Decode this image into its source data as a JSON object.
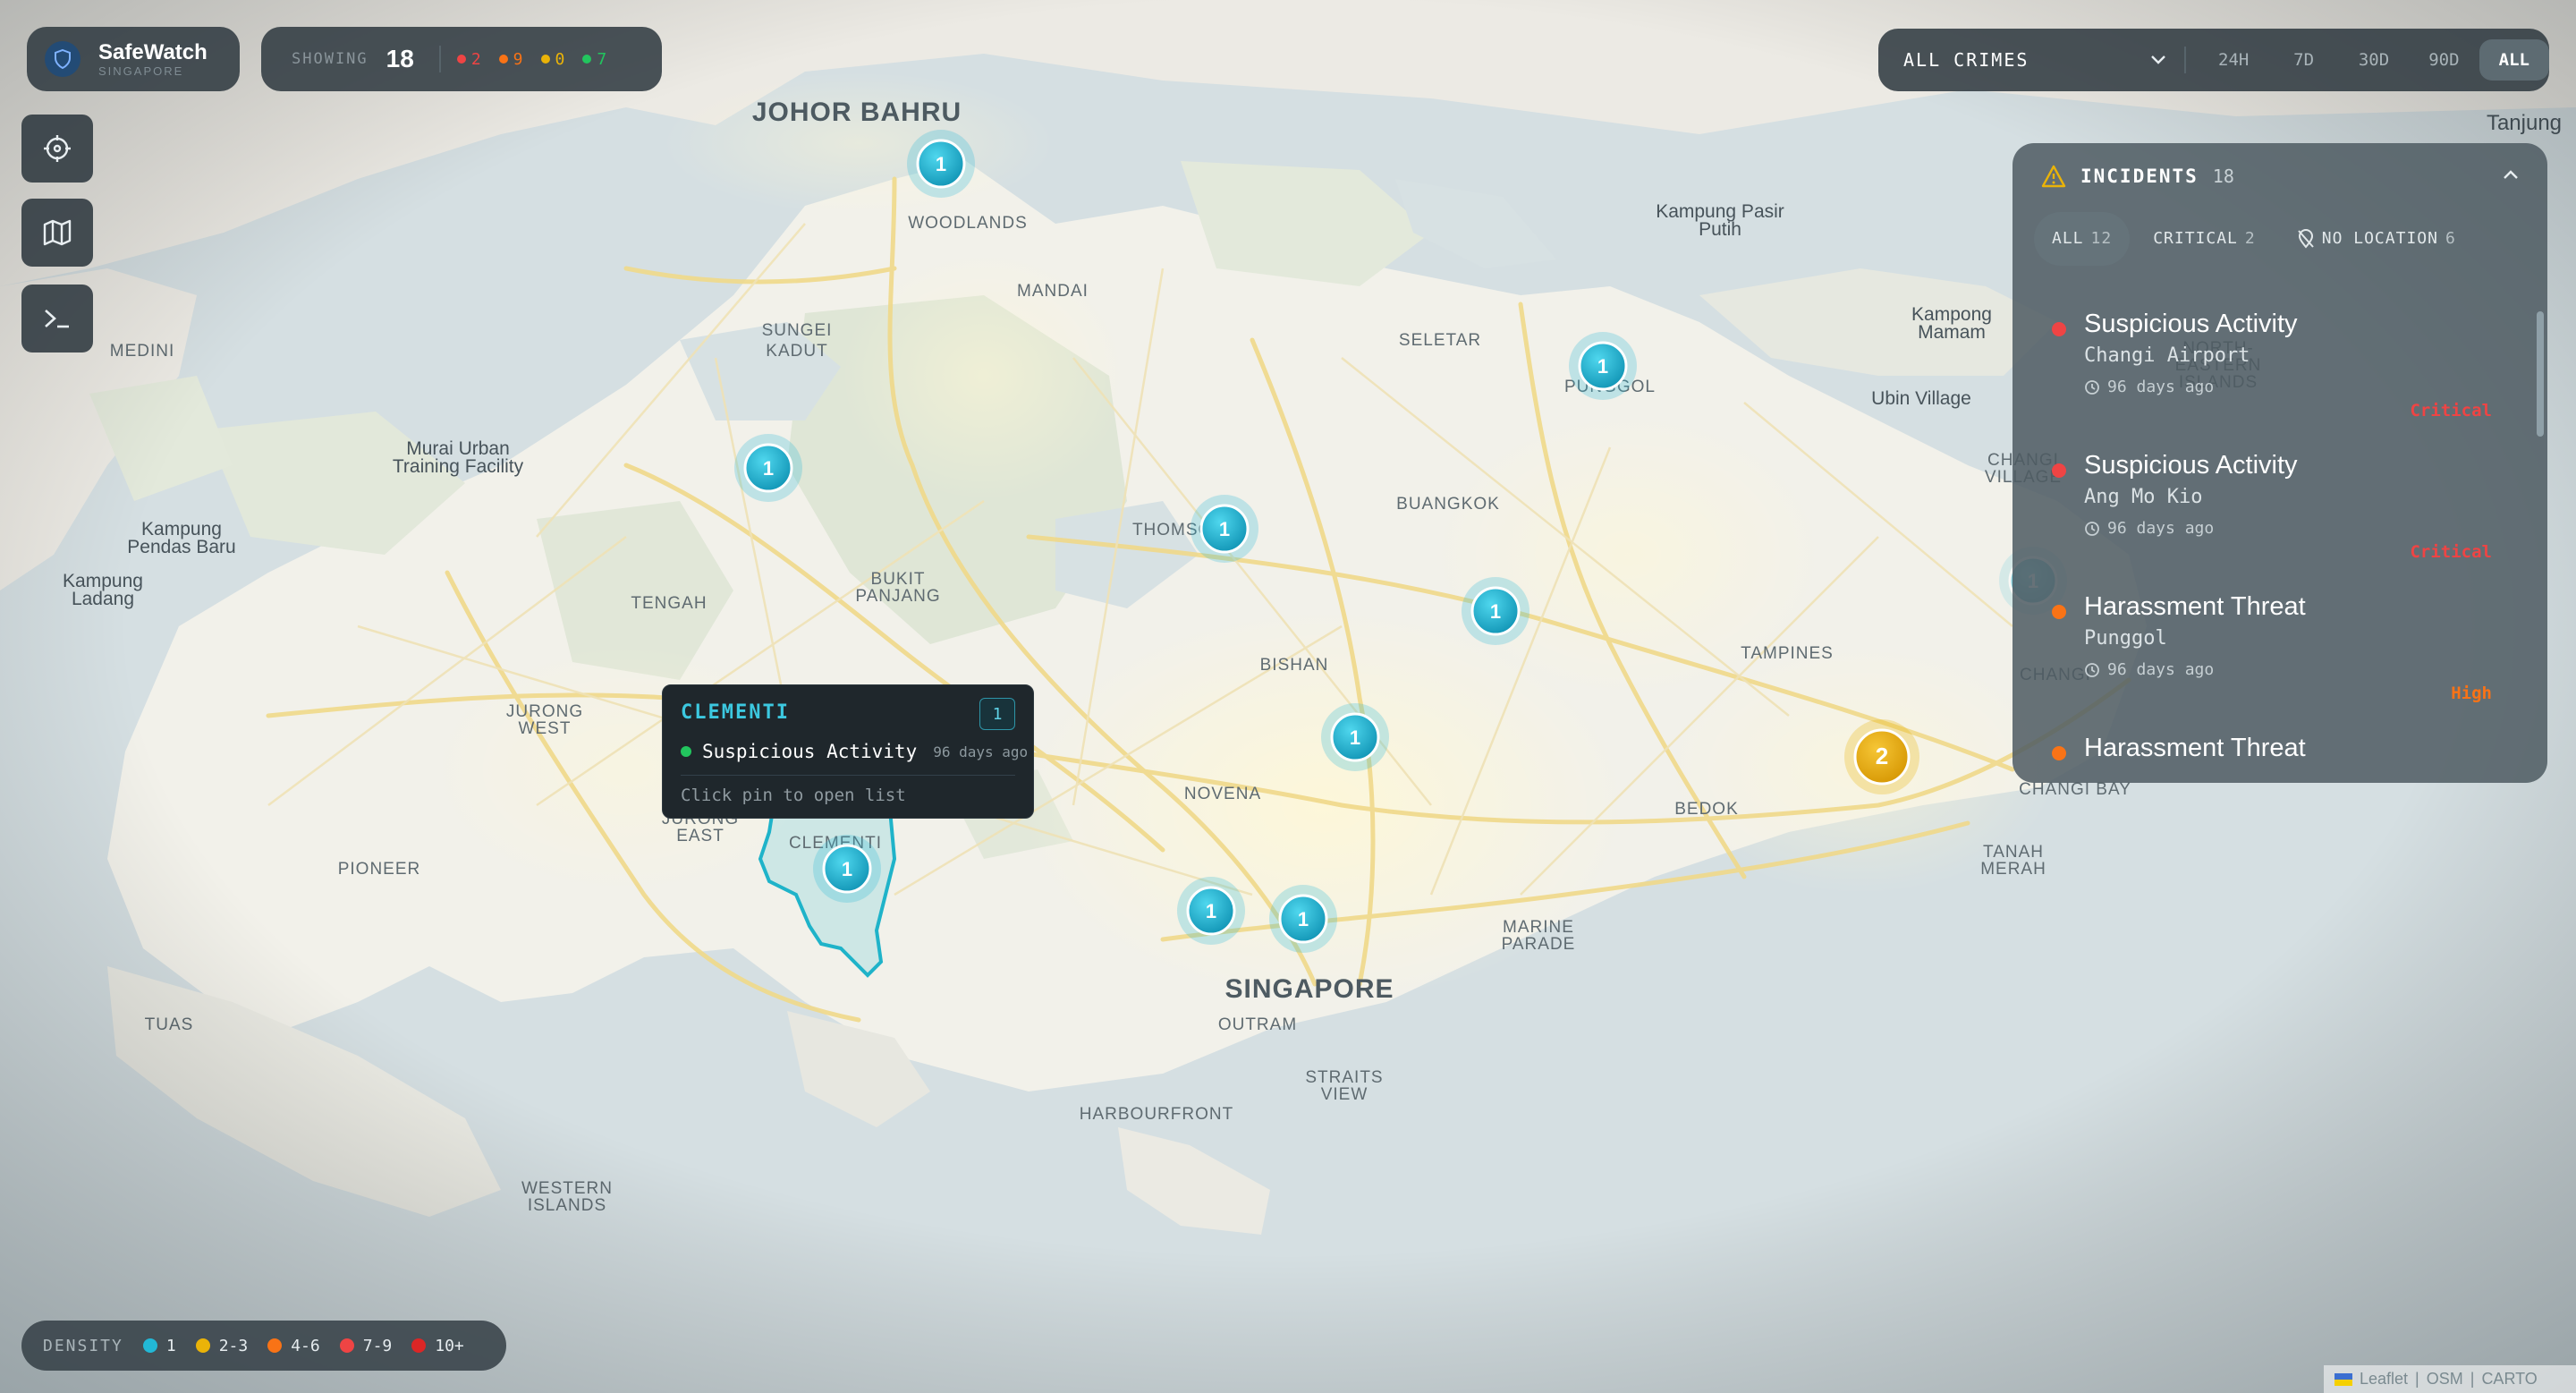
{
  "brand": {
    "name": "SafeWatch",
    "subtitle": "SINGAPORE",
    "icon": "shield-icon"
  },
  "stats": {
    "showing_label": "SHOWING",
    "showing_count": "18",
    "severity_counts": [
      {
        "key": "critical",
        "value": "2",
        "color": "#ef4444"
      },
      {
        "key": "high",
        "value": "9",
        "color": "#f97316"
      },
      {
        "key": "medium",
        "value": "0",
        "color": "#eab308"
      },
      {
        "key": "low",
        "value": "7",
        "color": "#22c55e"
      }
    ]
  },
  "tools": [
    {
      "name": "locate-button",
      "icon": "crosshair-icon"
    },
    {
      "name": "map-layers-button",
      "icon": "map-icon"
    },
    {
      "name": "terminal-button",
      "icon": "terminal-icon"
    }
  ],
  "filter": {
    "crime_type": "ALL CRIMES",
    "ranges": [
      "24H",
      "7D",
      "30D",
      "90D",
      "ALL"
    ],
    "active_range": "ALL"
  },
  "incidents": {
    "title": "INCIDENTS",
    "count": "18",
    "tabs": [
      {
        "label": "ALL",
        "count": "12",
        "active": true
      },
      {
        "label": "CRITICAL",
        "count": "2",
        "active": false
      },
      {
        "label": "NO LOCATION",
        "count": "6",
        "active": false,
        "icon": "location-off-icon"
      }
    ],
    "items": [
      {
        "title": "Suspicious Activity",
        "location": "Changi Airport",
        "time": "96 days ago",
        "severity": "Critical",
        "color": "#ef4444"
      },
      {
        "title": "Suspicious Activity",
        "location": "Ang Mo Kio",
        "time": "96 days ago",
        "severity": "Critical",
        "color": "#ef4444"
      },
      {
        "title": "Harassment Threat",
        "location": "Punggol",
        "time": "96 days ago",
        "severity": "High",
        "color": "#f97316"
      },
      {
        "title": "Harassment Threat",
        "location": "",
        "time": "",
        "severity": "",
        "color": "#f97316"
      }
    ]
  },
  "tooltip": {
    "title": "CLEMENTI",
    "count": "1",
    "incident": "Suspicious Activity",
    "age": "96 days ago",
    "hint": "Click pin to open list"
  },
  "legend": {
    "title": "DENSITY",
    "items": [
      {
        "label": "1",
        "color": "#22b8d6"
      },
      {
        "label": "2-3",
        "color": "#eab308"
      },
      {
        "label": "4-6",
        "color": "#f97316"
      },
      {
        "label": "7-9",
        "color": "#ef4444"
      },
      {
        "label": "10+",
        "color": "#dc2626"
      }
    ]
  },
  "map": {
    "labels": [
      "JOHOR BAHRU",
      "WOODLANDS",
      "MANDAI",
      "SUNGEI KADUT",
      "SELETAR",
      "PUNGGOL",
      "MEDINI",
      "Murai Urban Training Facility",
      "Kampung Pendas Baru",
      "Kampung Ladang",
      "TENGAH",
      "BUKIT PANJANG",
      "THOMSON",
      "BUANGKOK",
      "BISHAN",
      "JURONG WEST",
      "JURONG EAST",
      "CLEMENTI",
      "NOVENA",
      "TAMPINES",
      "BEDOK",
      "PIONEER",
      "TUAS",
      "SINGAPORE",
      "OUTRAM",
      "MARINE PARADE",
      "STRAITS VIEW",
      "HARBOURFRONT",
      "WESTERN ISLANDS",
      "TANAH MERAH",
      "CHANGI BAY",
      "CHANGI VILLAGE",
      "Kampung Pasir Putih",
      "Kampong Mamam",
      "Ubin Village",
      "NORTH-EASTERN ISLANDS",
      "Tanjung"
    ],
    "pins": [
      {
        "area": "Woodlands",
        "count": "1"
      },
      {
        "area": "Punggol",
        "count": "1"
      },
      {
        "area": "Choa Chu Kang",
        "count": "1"
      },
      {
        "area": "Thomson",
        "count": "1"
      },
      {
        "area": "Serangoon",
        "count": "1"
      },
      {
        "area": "Bishan",
        "count": "1"
      },
      {
        "area": "Clementi",
        "count": "1"
      },
      {
        "area": "Tiong Bahru",
        "count": "1"
      },
      {
        "area": "Outram",
        "count": "1"
      },
      {
        "area": "Tampines",
        "count": "2"
      },
      {
        "area": "Changi Airport",
        "count": "1"
      }
    ]
  },
  "attribution": {
    "leaflet": "Leaflet",
    "osm": "OSM",
    "carto": "CARTO",
    "sep": "|"
  }
}
